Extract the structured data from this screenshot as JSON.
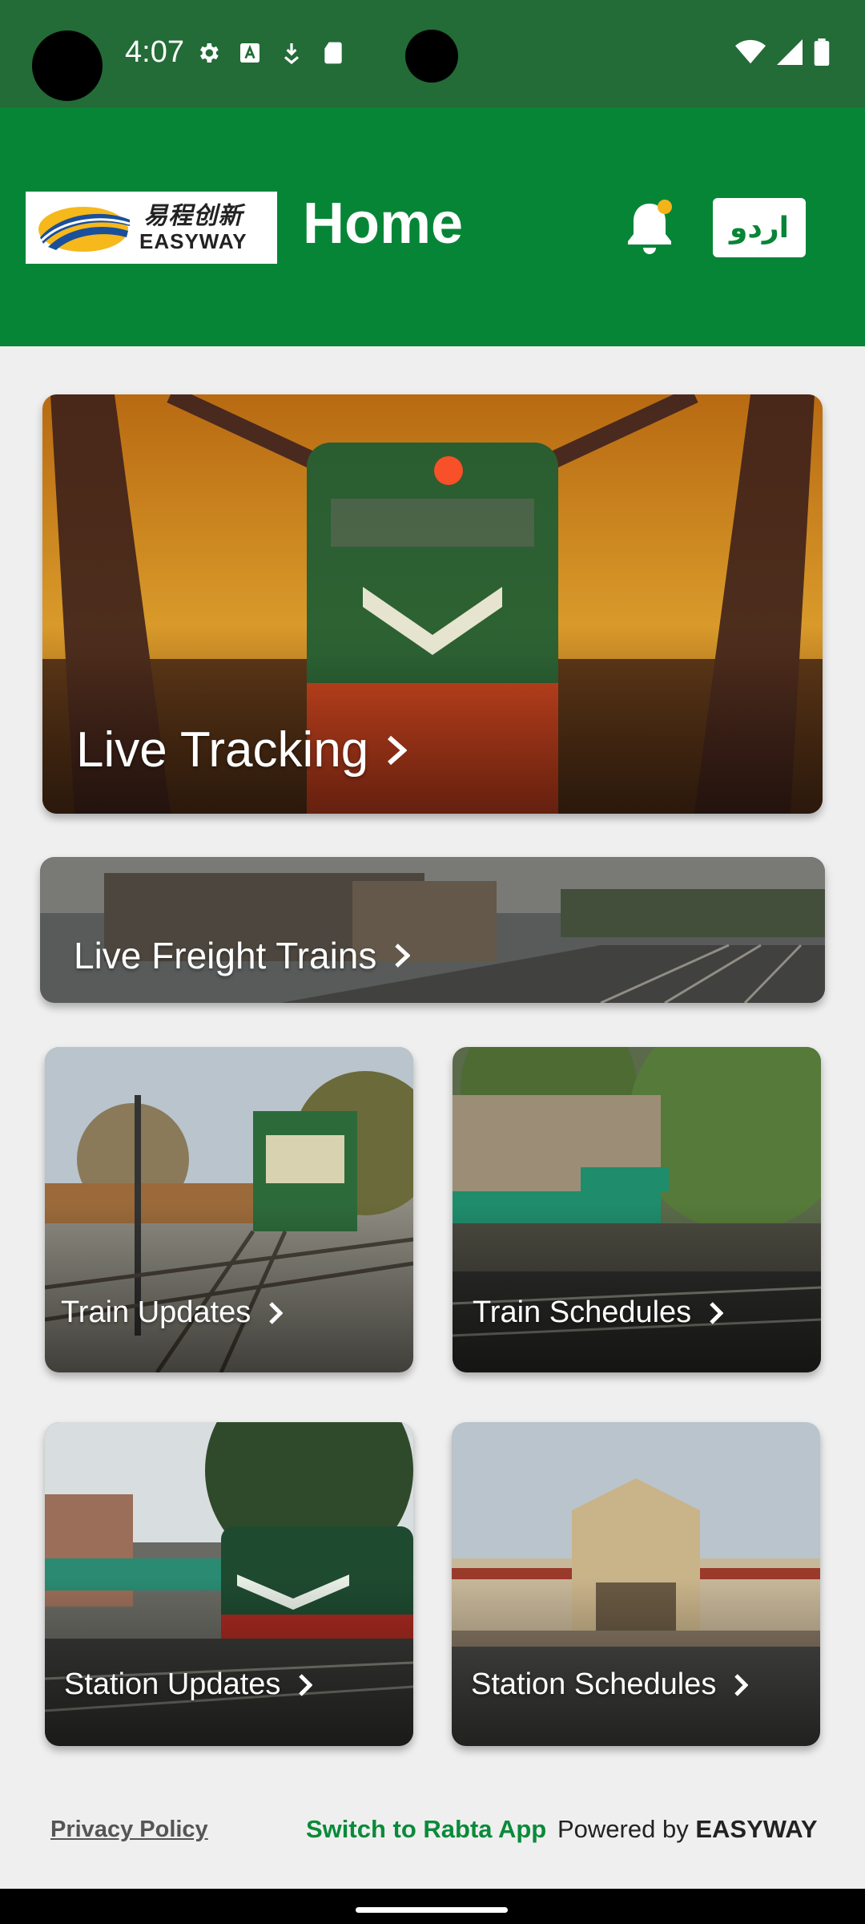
{
  "status_bar": {
    "time": "4:07",
    "left_icons": [
      "gear-icon",
      "font-a-icon",
      "download-icon",
      "sd-card-icon"
    ],
    "right_icons": [
      "wifi-icon",
      "signal-icon",
      "battery-icon"
    ],
    "background": "#236b37"
  },
  "header": {
    "logo_cn": "易程创新",
    "logo_en": "EASYWAY",
    "title": "Home",
    "notification_icon": "bell-icon",
    "language_button": "اردو",
    "background": "#078536"
  },
  "cards": {
    "live_tracking": "Live Tracking",
    "live_freight": "Live Freight Trains",
    "train_updates": "Train Updates",
    "train_schedules": "Train Schedules",
    "station_updates": "Station Updates",
    "station_schedules": "Station Schedules"
  },
  "footer": {
    "privacy_policy": "Privacy Policy",
    "switch_app": "Switch to Rabta App",
    "powered_by": "Powered by",
    "powered_brand": "EASYWAY"
  }
}
